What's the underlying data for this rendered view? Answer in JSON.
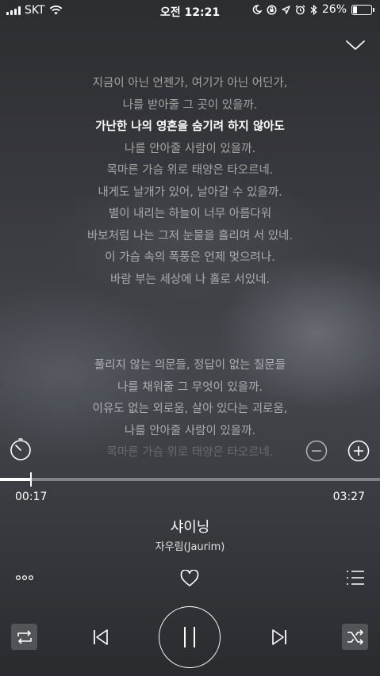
{
  "status_bar": {
    "carrier": "SKT",
    "time": "오전 12:21",
    "battery": "26%",
    "battery_level": 0.26,
    "icons": [
      "signal-icon",
      "wifi-icon",
      "moon-icon",
      "rotation-lock-icon",
      "location-icon",
      "alarm-icon",
      "bluetooth-icon",
      "battery-icon"
    ]
  },
  "lyrics": {
    "current_index": 2,
    "lines": [
      "지금이 아닌 언젠가, 여기가 아닌 어딘가,",
      "나를 받아줄 그 곳이 있을까.",
      "가난한 나의 영혼을 숨기려 하지 않아도",
      "나를 안아줄 사람이 있을까.",
      "목마른 가슴 위로 태양은 타오르네.",
      "내게도 날개가 있어, 날아갈 수 있을까.",
      "별이 내리는 하늘이 너무 아름다워",
      "바보처럼 나는 그저 눈물을 흘리며 서 있네.",
      "이 가슴 속의 폭풍은 언제 멎으려나.",
      "바람 부는 세상에 나 홀로 서있네."
    ],
    "lines_next": [
      "풀리지 않는 의문들, 정답이 없는 질문들",
      "나를 채워줄 그 무엇이 있을까.",
      "이유도 없는 외로움, 살아 있다는 괴로움,",
      "나를 안아줄 사람이 있을까.",
      "목마른 가슴 위로 태양은 타오르네."
    ]
  },
  "player": {
    "elapsed": "00:17",
    "duration": "03:27",
    "progress": 0.082,
    "title": "샤이닝",
    "artist": "자우림(Jaurim)",
    "state": "playing"
  }
}
